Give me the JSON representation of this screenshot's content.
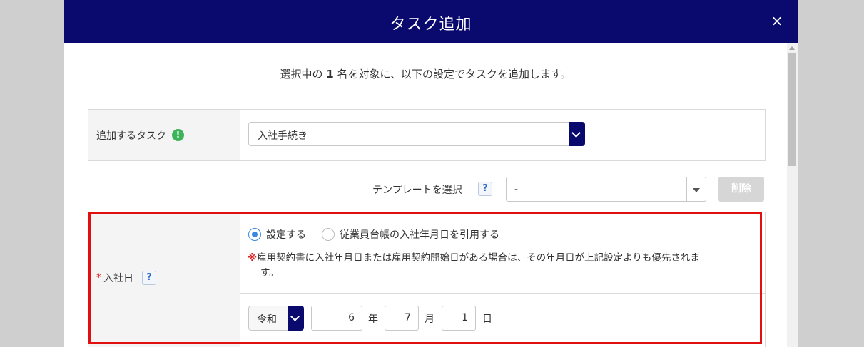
{
  "modal": {
    "title": "タスク追加",
    "close_label": "×"
  },
  "intro": {
    "prefix": "選択中の",
    "count": "1",
    "suffix": "名を対象に、以下の設定でタスクを追加します。"
  },
  "task_row": {
    "label": "追加するタスク",
    "info_icon": "!",
    "selected": "入社手続き"
  },
  "template": {
    "label": "テンプレートを選択",
    "help": "?",
    "selected": "-",
    "delete_label": "削除"
  },
  "hire_date": {
    "required_mark": "*",
    "label": "入社日",
    "help": "?",
    "options": [
      "設定する",
      "従業員台帳の入社年月日を引用する"
    ],
    "selected_option": "設定する",
    "notice_mark": "※",
    "notice_line1": "雇用契約書に入社年月日または雇用契約開始日がある場合は、その年月日が上記設定よりも優先されま",
    "notice_line2": "す。",
    "era": "令和",
    "year": "6",
    "year_unit": "年",
    "month": "7",
    "month_unit": "月",
    "day": "1",
    "day_unit": "日"
  },
  "colors": {
    "header": "#0a0a6e",
    "highlight": "#e01010",
    "radio_active": "#3a86e0",
    "info_green": "#3db35a"
  }
}
